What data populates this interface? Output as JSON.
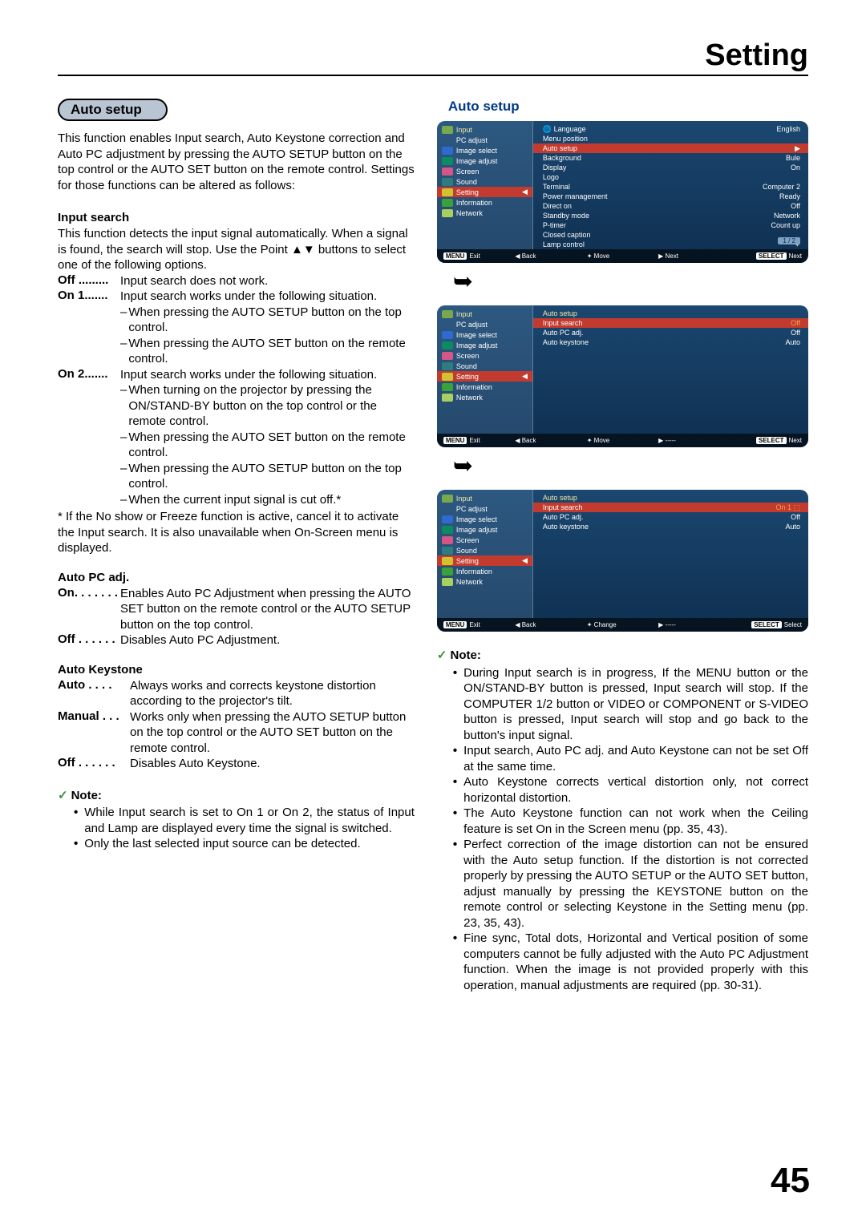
{
  "page": {
    "title": "Setting",
    "number": "45"
  },
  "left": {
    "pill": "Auto setup",
    "intro": "This function enables Input search, Auto Keystone correction and Auto PC adjustment by pressing the AUTO SETUP button on the top control or the AUTO SET button on the remote control. Settings for those functions can be altered as follows:",
    "input_search": {
      "heading": "Input search",
      "desc": "This function detects the input signal automatically. When a signal is found, the search will stop. Use the Point ▲▼ buttons to select one of the following options.",
      "off_label": "Off .........",
      "off_text": "Input search does not work.",
      "on1_label": "On 1.......",
      "on1_text": "Input search works under the following situation.",
      "on1_items": [
        "When pressing the AUTO SETUP button on the top control.",
        "When pressing the AUTO SET button on the remote control."
      ],
      "on2_label": "On 2.......",
      "on2_text": "Input search works under the following situation.",
      "on2_items": [
        "When turning on the projector by pressing the ON/STAND-BY button on the top control or the remote control.",
        "When pressing the AUTO SET button on the remote control.",
        "When pressing the AUTO SETUP button on the top control.",
        "When the current input signal is cut off.*"
      ],
      "star": "* If the No show or Freeze function is active, cancel it to activate the Input search. It is also unavailable when On-Screen menu is displayed."
    },
    "autopc": {
      "heading": "Auto PC adj.",
      "on_label": "On. . . . . . .",
      "on_text": "Enables Auto PC Adjustment when pressing the AUTO SET button on the remote control or the AUTO SETUP button on the top control.",
      "off_label": "Off  . . . . . .",
      "off_text": "Disables Auto PC Adjustment."
    },
    "autokey": {
      "heading": "Auto Keystone",
      "auto_label": "Auto  . . . .",
      "auto_text": "Always works and corrects keystone distortion according to the projector's tilt.",
      "manual_label": "Manual . . .",
      "manual_text": "Works only when pressing the AUTO SETUP button on the top control or the AUTO SET button on the remote control.",
      "off_label": "Off  . . . . . .",
      "off_text": "Disables Auto Keystone."
    },
    "note": {
      "heading": "Note:",
      "items": [
        "While Input search is set to On 1 or On 2, the status of Input and Lamp are displayed every time the signal is switched.",
        "Only the last selected input source can be detected."
      ]
    }
  },
  "right": {
    "title": "Auto setup",
    "note": {
      "heading": "Note:",
      "items": [
        "During Input search is in progress, If the MENU button or the ON/STAND-BY button is pressed, Input search will stop. If the COMPUTER 1/2 button or VIDEO or COMPONENT or S-VIDEO button is pressed, Input search will stop and go back to the button's input signal.",
        "Input search, Auto PC adj. and Auto Keystone can not be set Off at the same time.",
        "Auto Keystone corrects vertical distortion only, not correct horizontal distortion.",
        "The Auto Keystone function can not work when the Ceiling feature is set On in the Screen menu (pp. 35, 43).",
        "Perfect correction of the image distortion can not be ensured with the Auto setup function. If the distortion is not corrected properly by pressing the AUTO SETUP or the AUTO SET button, adjust manually by pressing the KEYSTONE button on the remote control or selecting Keystone in the Setting menu (pp. 23, 35, 43).",
        "Fine sync, Total dots, Horizontal and Vertical position of some computers cannot be fully adjusted with the Auto PC Adjustment function. When the image is not provided properly with this operation, manual adjustments are required (pp. 30-31)."
      ]
    }
  },
  "osd": {
    "side": [
      "Input",
      "PC adjust",
      "Image select",
      "Image adjust",
      "Screen",
      "Sound",
      "Setting",
      "Information",
      "Network"
    ],
    "menu1": {
      "title_left": "🌐 Language",
      "title_right": "English",
      "rows": [
        [
          "Menu position",
          ""
        ],
        [
          "Auto setup",
          ""
        ],
        [
          "Background",
          "Bule"
        ],
        [
          "Display",
          "On"
        ],
        [
          "Logo",
          ""
        ],
        [
          "Terminal",
          "Computer 2"
        ],
        [
          "Power management",
          "Ready"
        ],
        [
          "Direct on",
          "Off"
        ],
        [
          "Standby mode",
          "Network"
        ],
        [
          "P-timer",
          "Count up"
        ],
        [
          "Closed caption",
          ""
        ],
        [
          "Lamp control",
          "✦"
        ]
      ],
      "page": "1 / 2",
      "foot": [
        "Exit",
        "◀ Back",
        "✦ Move",
        "▶ Next",
        "Next"
      ]
    },
    "menu2": {
      "title": "Auto setup",
      "rows": [
        [
          "Input search",
          "Off"
        ],
        [
          "Auto PC adj.",
          "Off"
        ],
        [
          "Auto keystone",
          "Auto"
        ]
      ],
      "foot": [
        "Exit",
        "◀ Back",
        "✦ Move",
        "▶ -----",
        "Next"
      ]
    },
    "menu3": {
      "title": "Auto setup",
      "rows": [
        [
          "Input search",
          "On 1 ⬚"
        ],
        [
          "Auto PC adj.",
          "Off"
        ],
        [
          "Auto keystone",
          "Auto"
        ]
      ],
      "foot": [
        "Exit",
        "◀ Back",
        "✦ Change",
        "▶ -----",
        "Select"
      ]
    },
    "keys": {
      "menu": "MENU",
      "select": "SELECT"
    }
  }
}
